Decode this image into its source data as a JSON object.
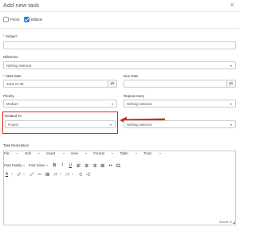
{
  "modal": {
    "title": "Add new task",
    "close": "×"
  },
  "checkboxes": [
    {
      "label": "Public",
      "checked": false
    },
    {
      "label": "Billable",
      "checked": true
    }
  ],
  "form": {
    "subject": {
      "label": "Subject",
      "required_mark": "*",
      "value": ""
    },
    "milestone": {
      "label": "Milestone",
      "value": "Nothing selected"
    },
    "start_date": {
      "label": "Start Date",
      "required_mark": "*",
      "value": "2016-12-08"
    },
    "due_date": {
      "label": "Due Date",
      "value": ""
    },
    "priority": {
      "label": "Priority",
      "value": "Medium"
    },
    "repeat_every": {
      "label": "Repeat every",
      "value": "Nothing selected"
    },
    "related_to": {
      "label": "Related To",
      "value": "Project"
    },
    "related_item": {
      "value": "Nothing selected"
    },
    "task_description": {
      "label": "Task Description"
    }
  },
  "editor": {
    "menu": [
      "File",
      "Edit",
      "Insert",
      "View",
      "Format",
      "Table",
      "Tools"
    ],
    "font_family": "Font Family",
    "font_sizes": "Font Sizes",
    "bold": "B",
    "italic": "I",
    "underline": "U",
    "words": "Words: 0"
  },
  "colors": {
    "highlight": "#e0261b",
    "accent": "#2b7bd6"
  }
}
